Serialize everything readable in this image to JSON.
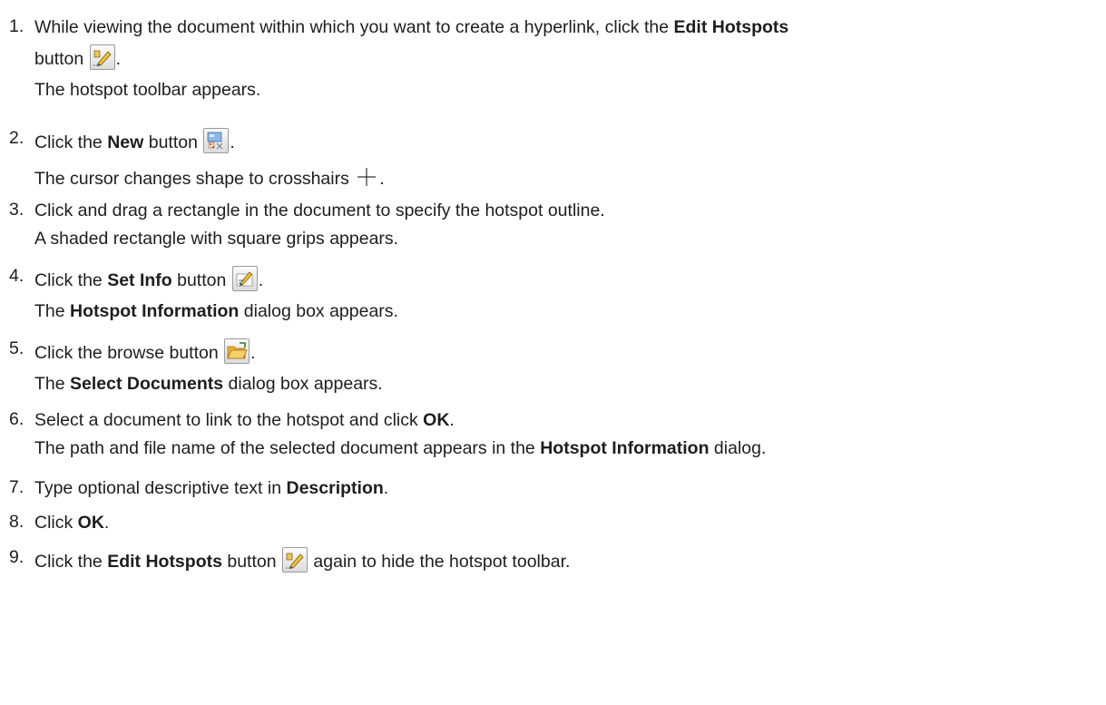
{
  "steps": [
    {
      "number": "1.",
      "line1_before": "While viewing the document within which you want to create a hyperlink, click the ",
      "line1_bold": "Edit Hotspots",
      "line2_before": "button ",
      "line2_after": ".",
      "result": "The hotspot toolbar appears.",
      "icon": "edit-hotspots-icon"
    },
    {
      "number": "2.",
      "text_before": "Click the ",
      "bold": "New",
      "text_after": " button ",
      "end": ".",
      "result_before": "The cursor changes shape to crosshairs ",
      "result_after": ".",
      "icon": "new-hotspot-icon",
      "result_icon": "crosshairs-icon"
    },
    {
      "number": "3.",
      "text": "Click and drag a rectangle in the document to specify the hotspot outline.",
      "result": "A shaded rectangle with square grips appears."
    },
    {
      "number": "4.",
      "text_before": "Click the ",
      "bold": "Set Info",
      "text_after": " button ",
      "end": ".",
      "result_before": "The ",
      "result_bold": "Hotspot Information",
      "result_after": " dialog box appears.",
      "icon": "set-info-icon"
    },
    {
      "number": "5.",
      "text": "Click the browse button ",
      "end": ".",
      "result_before": "The ",
      "result_bold": "Select Documents",
      "result_after": " dialog box appears.",
      "icon": "browse-folder-icon"
    },
    {
      "number": "6.",
      "text_before": "Select a document to link to the hotspot and click ",
      "bold": "OK",
      "end": ".",
      "result_before": "The path and file name of the selected document appears in the ",
      "result_bold": "Hotspot Information",
      "result_after": " dialog."
    },
    {
      "number": "7.",
      "text_before": "Type optional descriptive text in ",
      "bold": "Description",
      "end": "."
    },
    {
      "number": "8.",
      "text_before": "Click ",
      "bold": "OK",
      "end": "."
    },
    {
      "number": "9.",
      "text_before": "Click the ",
      "bold": "Edit Hotspots",
      "text_after": " button ",
      "end": " again to hide the hotspot toolbar.",
      "icon": "edit-hotspots-icon"
    }
  ]
}
